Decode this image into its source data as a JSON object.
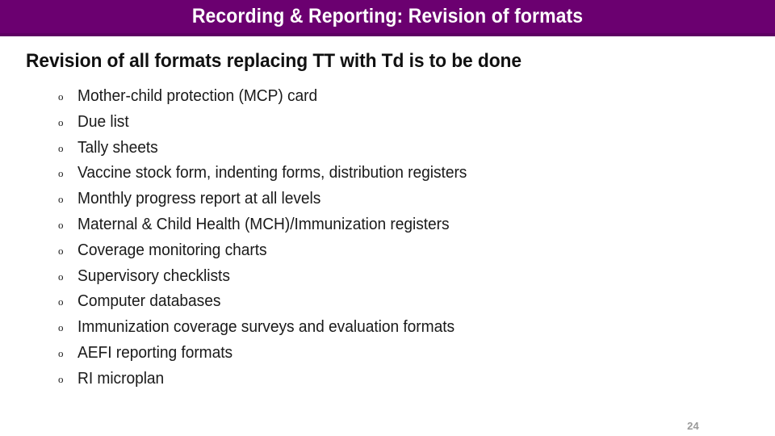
{
  "slide": {
    "title": "Recording & Reporting: Revision of formats",
    "subtitle": "Revision of all formats replacing TT with Td is to be done",
    "page_number": "24",
    "bullet_marker": "o",
    "colors": {
      "title_bar": "#6b0070",
      "title_bar_edge": "#5e0063",
      "title_text": "#ffffff",
      "subtitle_text": "#111111",
      "body_text": "#1a1a1a",
      "page_number_text": "#9a9a9a",
      "background": "#ffffff"
    },
    "bullets": [
      {
        "label": "Mother-child protection (MCP) card"
      },
      {
        "label": "Due list"
      },
      {
        "label": "Tally sheets"
      },
      {
        "label": "Vaccine stock form, indenting forms, distribution registers"
      },
      {
        "label": "Monthly progress report at all levels"
      },
      {
        "label": "Maternal & Child Health (MCH)/Immunization registers"
      },
      {
        "label": "Coverage monitoring charts"
      },
      {
        "label": "Supervisory checklists"
      },
      {
        "label": "Computer databases"
      },
      {
        "label": "Immunization coverage surveys and evaluation formats"
      },
      {
        "label": "AEFI reporting formats"
      },
      {
        "label": "RI microplan"
      }
    ]
  }
}
